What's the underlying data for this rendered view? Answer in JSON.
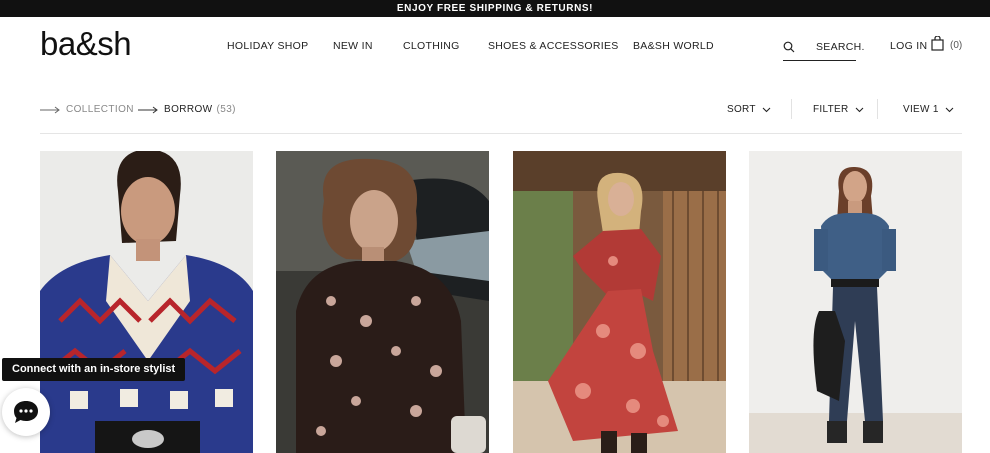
{
  "promo": {
    "text": "ENJOY FREE SHIPPING & RETURNS!"
  },
  "brand": {
    "logo_text": "ba&sh"
  },
  "nav": {
    "items": [
      {
        "label": "HOLIDAY SHOP"
      },
      {
        "label": "NEW IN"
      },
      {
        "label": "CLOTHING"
      },
      {
        "label": "SHOES & ACCESSORIES"
      },
      {
        "label": "BA&SH WORLD"
      }
    ]
  },
  "header": {
    "search_label": "SEARCH.",
    "login_label": "LOG IN",
    "cart_count": "(0)"
  },
  "breadcrumb": {
    "collection": "COLLECTION",
    "current": "BORROW",
    "count": "(53)"
  },
  "controls": {
    "sort": "SORT",
    "filter": "FILTER",
    "view": "VIEW 1"
  },
  "products": [
    {
      "image": "model-in-blue-geometric-print-blouse"
    },
    {
      "image": "model-in-black-paisley-print-blouse"
    },
    {
      "image": "model-in-red-floral-maxi-dress"
    },
    {
      "image": "model-in-denim-shirt-and-jeans"
    }
  ],
  "chat": {
    "stylist_label": "Connect with an in-store stylist",
    "icon": "chat-bubble-icon"
  },
  "colors": {
    "promo_bg": "#111111",
    "text": "#222222",
    "muted": "#888888"
  }
}
